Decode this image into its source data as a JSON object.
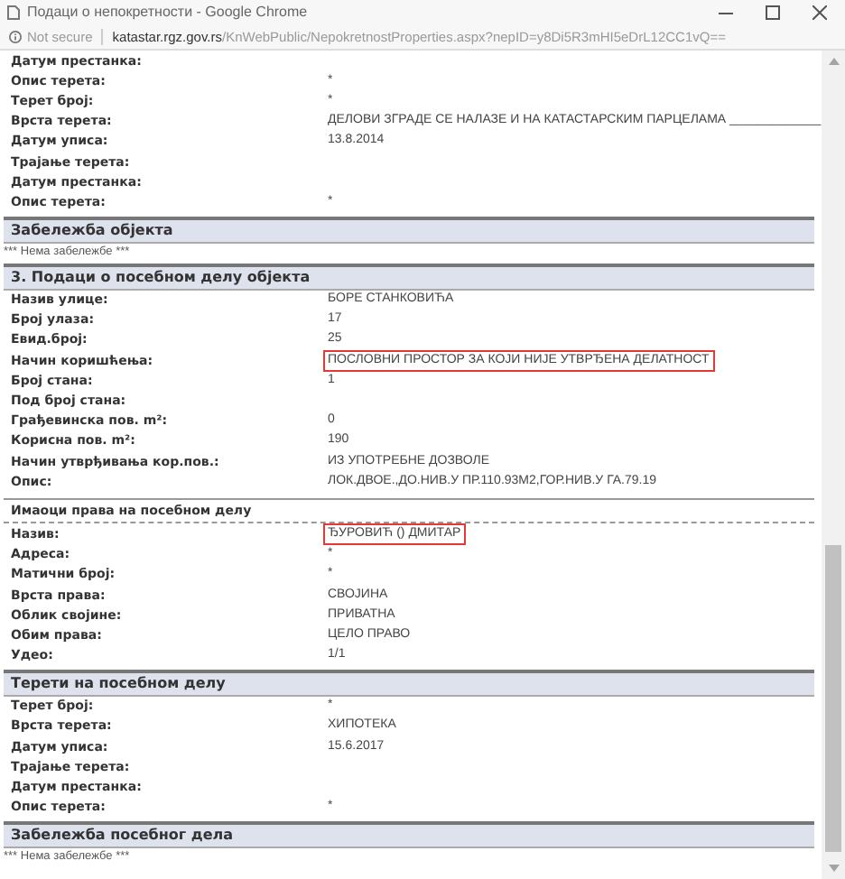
{
  "window": {
    "title": "Подаци о непокретности - Google Chrome"
  },
  "address_bar": {
    "security": "Not secure",
    "host": "katastar.rgz.gov.rs",
    "path": "/KnWebPublic/NepokretnostProperties.aspx?nepID=y8Di5R3mHI5eDrL12CC1vQ=="
  },
  "blocks": [
    {
      "kind": "rows",
      "rows": [
        {
          "label": "Датум престанка:",
          "value": "",
          "highlighted": false
        },
        {
          "label": "Опис терета:",
          "value": "*",
          "highlighted": false
        },
        {
          "label": "Терет број:",
          "value": "*",
          "highlighted": false
        },
        {
          "label": "Врста терета:",
          "value": "ДЕЛОВИ ЗГРАДЕ СЕ НАЛАЗЕ И НА КАТАСТАРСКИМ ПАРЦЕЛАМА _____________",
          "highlighted": false
        },
        {
          "label": "Датум уписа:",
          "value": "13.8.2014",
          "highlighted": false
        },
        {
          "label": "Трајање терета:",
          "value": "",
          "highlighted": false
        },
        {
          "label": "Датум престанка:",
          "value": "",
          "highlighted": false
        },
        {
          "label": "Опис терета:",
          "value": "*",
          "highlighted": false
        }
      ]
    },
    {
      "kind": "header",
      "text": "Забележба објекта"
    },
    {
      "kind": "note",
      "text": "*** Нема забележбе ***"
    },
    {
      "kind": "header",
      "text": "3. Подаци о посебном делу објекта"
    },
    {
      "kind": "rows",
      "rows": [
        {
          "label": "Назив улице:",
          "value": "БОРЕ СТАНКОВИЋА",
          "highlighted": false
        },
        {
          "label": "Број улаза:",
          "value": "17",
          "highlighted": false
        },
        {
          "label": "Евид.број:",
          "value": "25",
          "highlighted": false
        },
        {
          "label": "Начин коришћења:",
          "value": "ПОСЛОВНИ ПРОСТОР ЗА КОЈИ НИЈЕ УТВРЂЕНА ДЕЛАТНОСТ",
          "highlighted": true
        },
        {
          "label": "Број стана:",
          "value": "1",
          "highlighted": false
        },
        {
          "label": "Под број стана:",
          "value": "",
          "highlighted": false
        },
        {
          "label": "Грађевинска пов. m²:",
          "value": "0",
          "highlighted": false
        },
        {
          "label": "Корисна пов. m²:",
          "value": "190",
          "highlighted": false
        },
        {
          "label": "Начин утврђивања кор.пов.:",
          "value": "ИЗ УПОТРЕБНЕ ДОЗВОЛЕ",
          "highlighted": false
        },
        {
          "label": "Опис:",
          "value": "ЛОК.ДВОЕ.,ДО.НИВ.У ПР.110.93М2,ГОР.НИВ.У ГА.79.19",
          "highlighted": false
        }
      ]
    },
    {
      "kind": "subheader",
      "text": "Имаоци права на посебном делу"
    },
    {
      "kind": "rows",
      "rows": [
        {
          "label": "Назив:",
          "value": "ЂУРОВИЋ () ДМИТАР",
          "highlighted": true
        },
        {
          "label": "Адреса:",
          "value": "*",
          "highlighted": false
        },
        {
          "label": "Матични број:",
          "value": "*",
          "highlighted": false
        },
        {
          "label": "Врста права:",
          "value": "СВОЈИНА",
          "highlighted": false
        },
        {
          "label": "Облик својине:",
          "value": "ПРИВАТНА",
          "highlighted": false
        },
        {
          "label": "Обим права:",
          "value": "ЦЕЛО ПРАВО",
          "highlighted": false
        },
        {
          "label": "Удео:",
          "value": "1/1",
          "highlighted": false
        }
      ]
    },
    {
      "kind": "header",
      "text": "Терети на посебном делу"
    },
    {
      "kind": "rows",
      "rows": [
        {
          "label": "Терет број:",
          "value": "*",
          "highlighted": false
        },
        {
          "label": "Врста терета:",
          "value": "ХИПОТЕКА",
          "highlighted": false
        },
        {
          "label": "Датум уписа:",
          "value": "15.6.2017",
          "highlighted": false
        },
        {
          "label": "Трајање терета:",
          "value": "",
          "highlighted": false
        },
        {
          "label": "Датум престанка:",
          "value": "",
          "highlighted": false
        },
        {
          "label": "Опис терета:",
          "value": "*",
          "highlighted": false
        }
      ]
    },
    {
      "kind": "header",
      "text": "Забележба посебног дела"
    },
    {
      "kind": "note",
      "text": "*** Нема забележбе ***"
    }
  ]
}
